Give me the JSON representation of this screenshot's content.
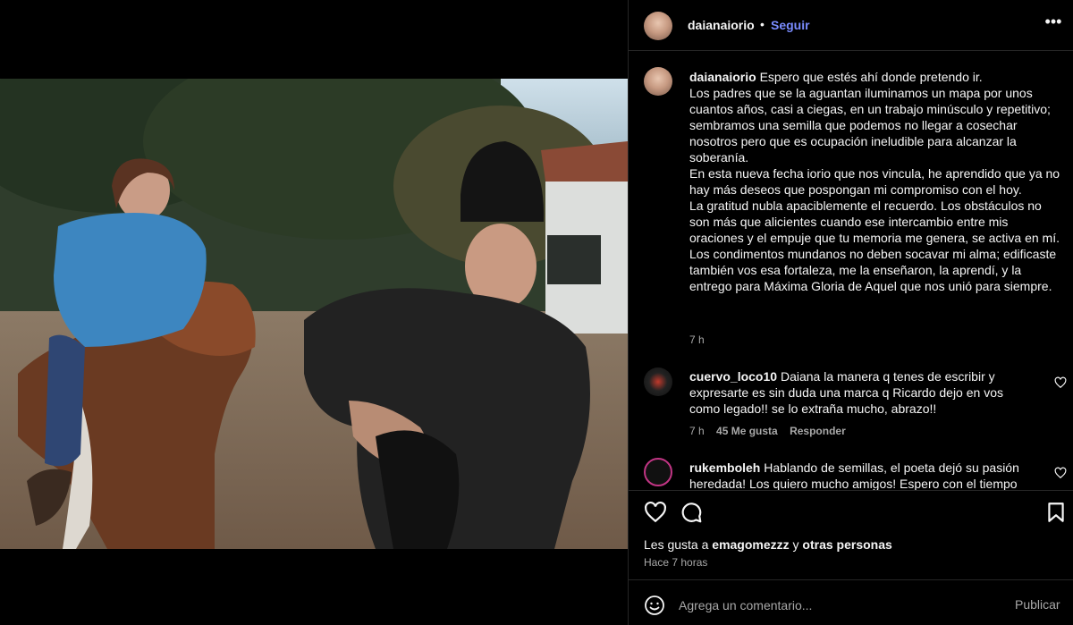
{
  "post": {
    "username": "daianaiorio",
    "dot": "•",
    "follow_label": "Seguir",
    "more_label": "•••"
  },
  "caption": {
    "username": "daianaiorio",
    "text": "Espero que estés ahí donde pretendo ir.\nLos padres que se la aguantan iluminamos un mapa por unos cuantos años, casi a ciegas, en un trabajo minúsculo y repetitivo; sembramos una semilla que podemos no llegar a cosechar nosotros pero que es ocupación ineludible para alcanzar la soberanía.\nEn esta nueva fecha iorio que nos vincula, he aprendido que ya no hay más deseos que pospongan mi compromiso con el hoy.\nLa gratitud nubla apaciblemente el recuerdo. Los obstáculos no son más que alicientes cuando ese intercambio entre mis oraciones y el empuje que tu memoria me genera, se activa en mí. Los condimentos mundanos no deben socavar mi alma; edificaste también vos esa fortaleza, me la enseñaron, la aprendí, y la entrego para Máxima Gloria de Aquel que nos unió para siempre.",
    "time": "7 h"
  },
  "comments": [
    {
      "username": "cuervo_loco10",
      "text": "Daiana la manera q tenes de escribir y expresarte es sin duda una marca q Ricardo dejo en vos como legado!! se lo extraña mucho, abrazo!!",
      "time": "7 h",
      "likes": "45 Me gusta",
      "reply": "Responder"
    },
    {
      "username": "rukemboleh",
      "text": "Hablando de semillas, el poeta dejó su pasión heredada! Los quiero mucho amigos! Espero con el tiempo"
    }
  ],
  "likes": {
    "prefix": "Les gusta a",
    "user": "emagomezzz",
    "and": "y",
    "others": "otras personas"
  },
  "date": "Hace 7 horas",
  "add_comment": {
    "placeholder": "Agrega un comentario...",
    "publish_label": "Publicar"
  },
  "colors": {
    "accent": "#7a8cff",
    "background": "#000000",
    "muted": "#a8a8a8"
  },
  "icons": [
    "like-icon",
    "comment-icon",
    "save-icon",
    "emoji-icon",
    "heart-icon",
    "more-icon"
  ]
}
